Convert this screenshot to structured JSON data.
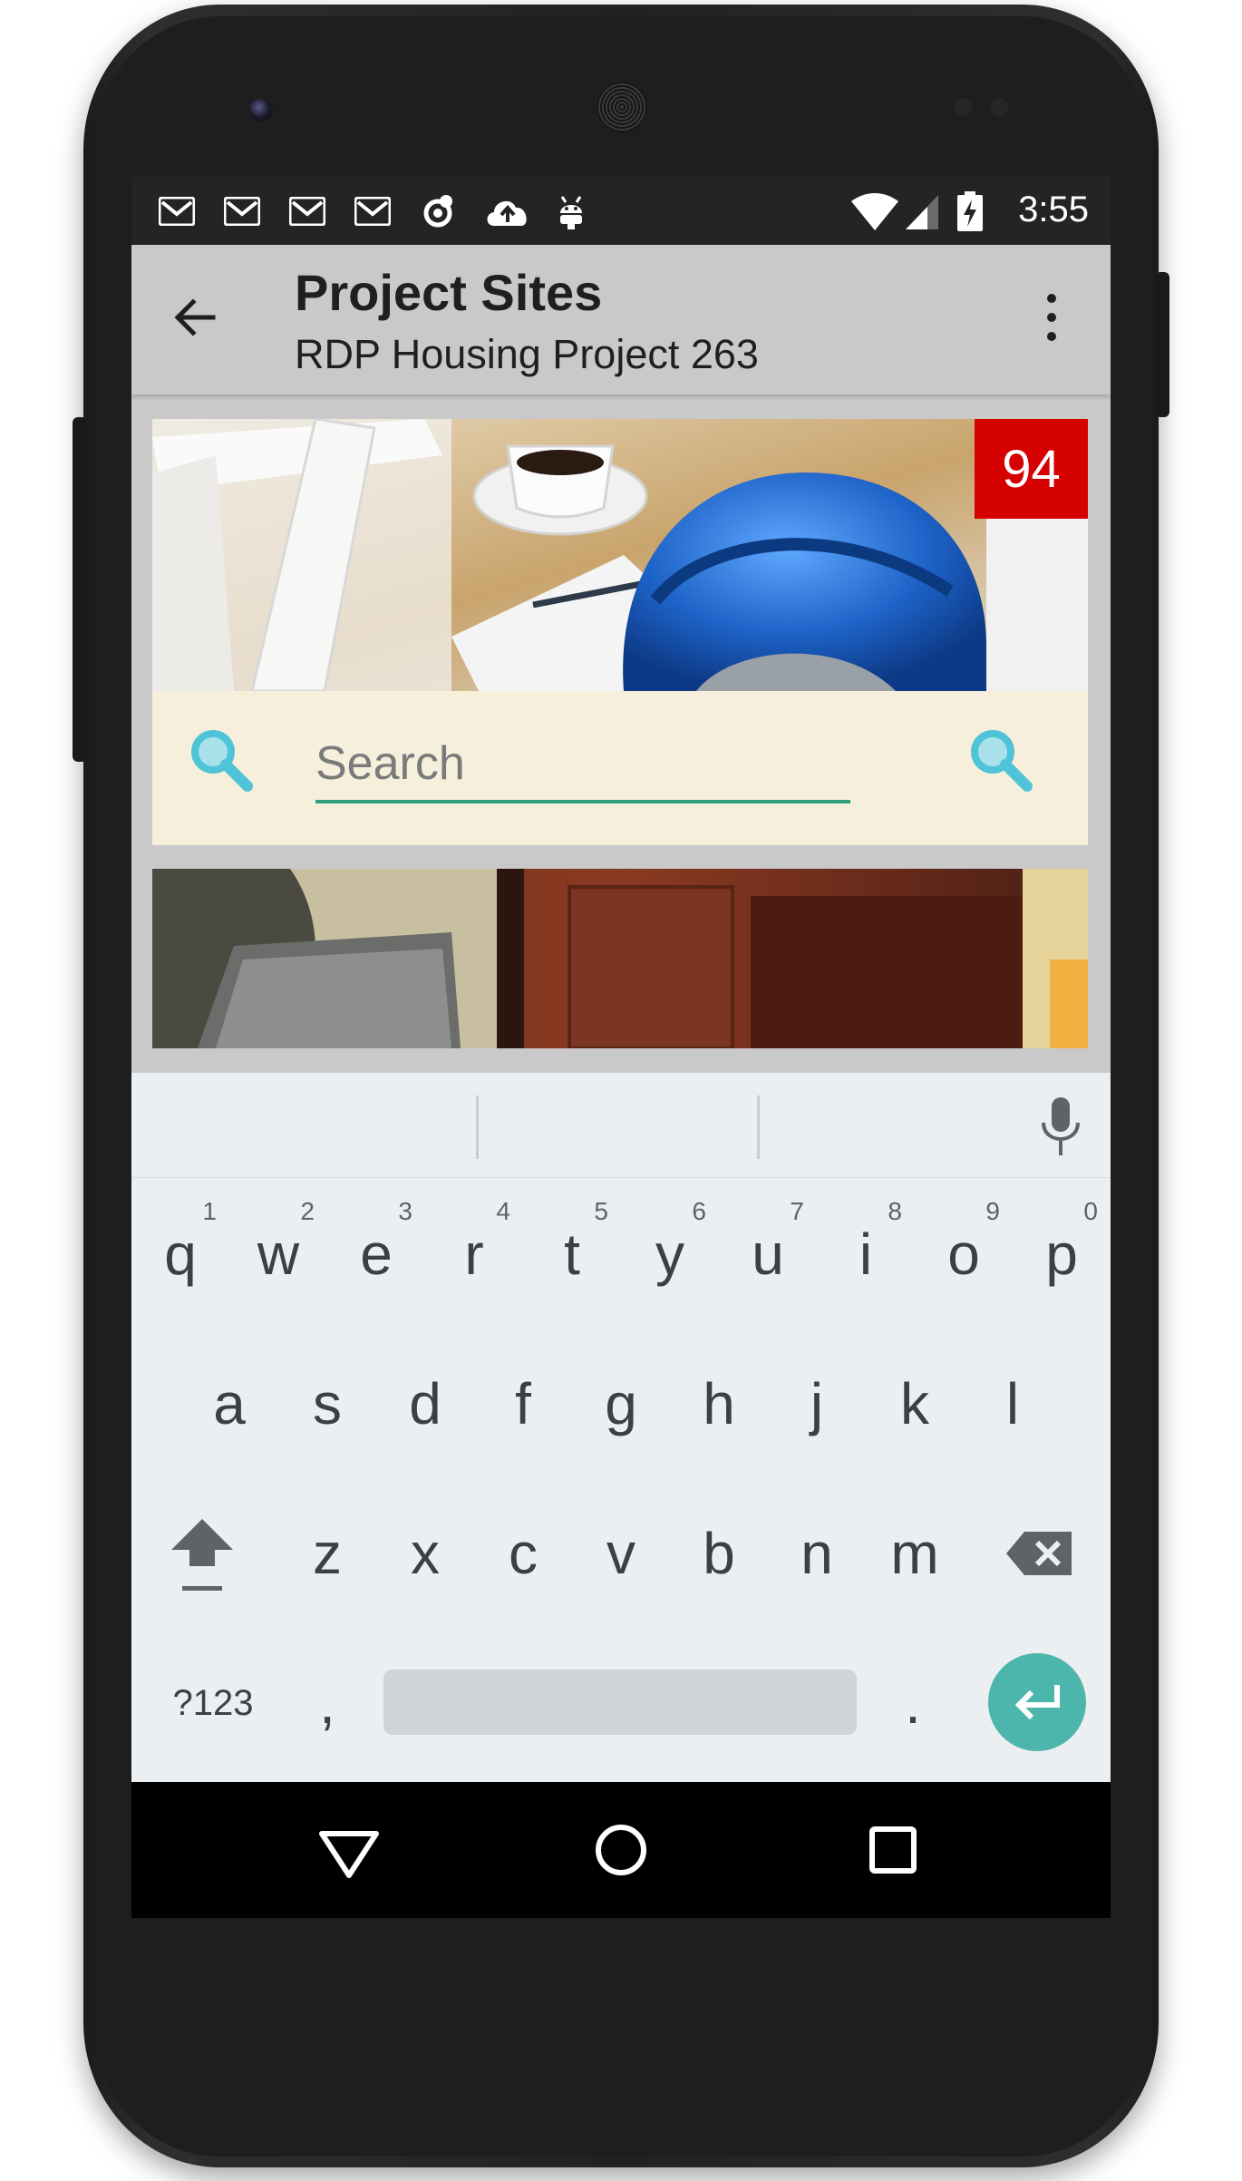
{
  "status_bar": {
    "time": "3:55",
    "icons": [
      "gmail-icon",
      "gmail-icon",
      "gmail-icon",
      "gmail-icon",
      "sync-icon",
      "cloud-upload-icon",
      "android-icon"
    ],
    "right_icons": [
      "wifi-icon",
      "signal-icon",
      "battery-charging-icon"
    ]
  },
  "app_bar": {
    "title": "Project Sites",
    "subtitle": "RDP Housing Project 263"
  },
  "cards": [
    {
      "badge": "94",
      "search": {
        "placeholder": "Search",
        "value": ""
      }
    },
    {}
  ],
  "keyboard": {
    "row1": [
      {
        "key": "q",
        "hint": "1"
      },
      {
        "key": "w",
        "hint": "2"
      },
      {
        "key": "e",
        "hint": "3"
      },
      {
        "key": "r",
        "hint": "4"
      },
      {
        "key": "t",
        "hint": "5"
      },
      {
        "key": "y",
        "hint": "6"
      },
      {
        "key": "u",
        "hint": "7"
      },
      {
        "key": "i",
        "hint": "8"
      },
      {
        "key": "o",
        "hint": "9"
      },
      {
        "key": "p",
        "hint": "0"
      }
    ],
    "row2": [
      "a",
      "s",
      "d",
      "f",
      "g",
      "h",
      "j",
      "k",
      "l"
    ],
    "row3": [
      "z",
      "x",
      "c",
      "v",
      "b",
      "n",
      "m"
    ],
    "symbols_label": "?123",
    "comma": ",",
    "period": "."
  },
  "colors": {
    "badge": "#d50000",
    "accent": "#2e9e7f",
    "enter_key": "#4db6ac",
    "search_icon": "#4fc3d8",
    "search_bar": "#f5efdc"
  }
}
